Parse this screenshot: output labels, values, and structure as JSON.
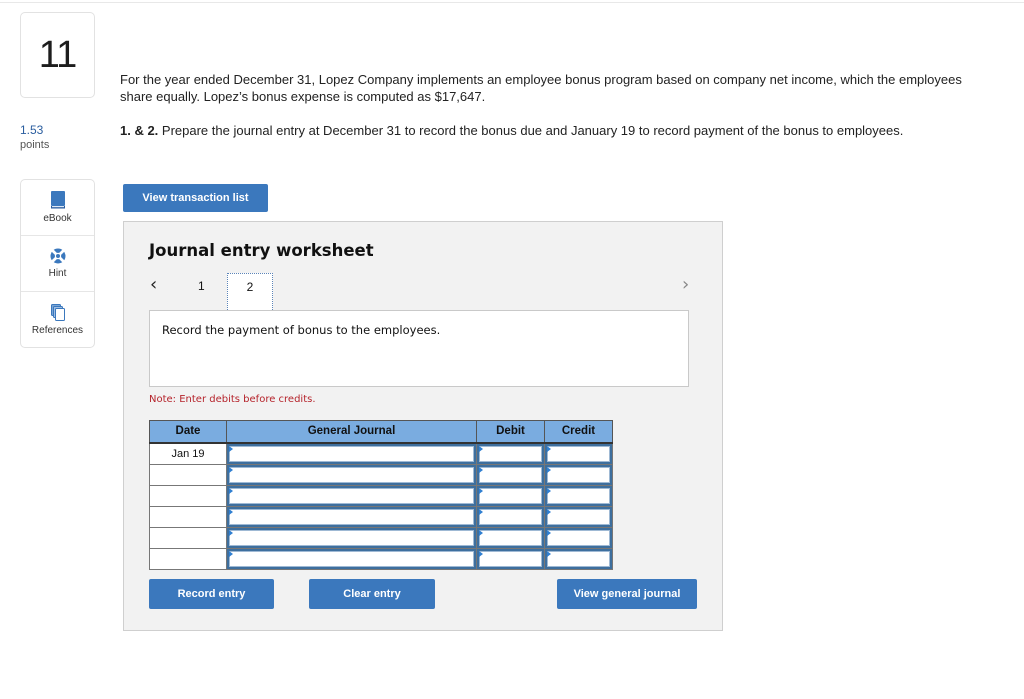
{
  "question": {
    "number": "11",
    "points_value": "1.53",
    "points_label": "points"
  },
  "tools": [
    {
      "label": "eBook",
      "icon": "book-icon"
    },
    {
      "label": "Hint",
      "icon": "lifebuoy-icon"
    },
    {
      "label": "References",
      "icon": "copy-pages-icon"
    }
  ],
  "prompt": "For the year ended December 31, Lopez Company implements an employee bonus program based on company net income, which the employees share equally. Lopez’s bonus expense is computed as $17,647.",
  "task": {
    "prefix": "1. & 2.",
    "text": " Prepare the journal entry at December 31 to record the bonus due and January 19 to record payment of the bonus to employees."
  },
  "buttons": {
    "view_transaction_list": "View transaction list",
    "record_entry": "Record entry",
    "clear_entry": "Clear entry",
    "view_general_journal": "View general journal"
  },
  "worksheet": {
    "title": "Journal entry worksheet",
    "prev_icon": "‹",
    "next_icon": "›",
    "pages": [
      "1",
      "2"
    ],
    "current_page": "2",
    "description": "Record the payment of bonus to the employees.",
    "note": "Note: Enter debits before credits.",
    "table": {
      "headers": [
        "Date",
        "General Journal",
        "Debit",
        "Credit"
      ],
      "rows": [
        {
          "date": "Jan 19",
          "account": "",
          "debit": "",
          "credit": ""
        },
        {
          "date": "",
          "account": "",
          "debit": "",
          "credit": ""
        },
        {
          "date": "",
          "account": "",
          "debit": "",
          "credit": ""
        },
        {
          "date": "",
          "account": "",
          "debit": "",
          "credit": ""
        },
        {
          "date": "",
          "account": "",
          "debit": "",
          "credit": ""
        },
        {
          "date": "",
          "account": "",
          "debit": "",
          "credit": ""
        }
      ]
    }
  },
  "colors": {
    "accent": "#3b78bd",
    "header_blue": "#7aace0",
    "note_red": "#b5232b",
    "points_blue": "#2a5d9f"
  }
}
